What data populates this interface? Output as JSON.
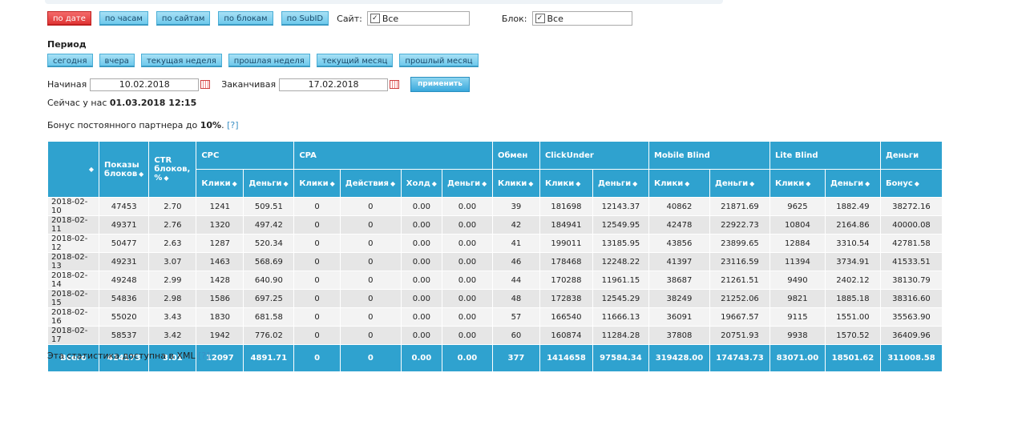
{
  "tabs": [
    "по дате",
    "по часам",
    "по сайтам",
    "по блокам",
    "по SubID"
  ],
  "filters": {
    "site_label": "Сайт:",
    "site_value": "Все",
    "block_label": "Блок:",
    "block_value": "Все"
  },
  "period": {
    "title": "Период",
    "buttons": [
      "сегодня",
      "вчера",
      "текущая неделя",
      "прошлая неделя",
      "текущий месяц",
      "прошлый месяц"
    ]
  },
  "dates": {
    "start_label": "Начиная",
    "start_value": "10.02.2018",
    "end_label": "Заканчивая",
    "end_value": "17.02.2018",
    "apply": "применить"
  },
  "now": {
    "prefix": "Сейчас у нас",
    "value": "01.03.2018 12:15"
  },
  "bonus": {
    "prefix": "Бонус постоянного партнера до",
    "value": "10%",
    "suffix": ".",
    "help": "[?]"
  },
  "table": {
    "groups": [
      "Показы блоков",
      "CTR блоков, %",
      "CPC",
      "CPA",
      "Обмен",
      "ClickUnder",
      "Mobile Blind",
      "Lite Blind",
      "Деньги"
    ],
    "sub": [
      "Клики",
      "Деньги",
      "Клики",
      "Действия",
      "Холд",
      "Деньги",
      "Клики",
      "Клики",
      "Деньги",
      "Клики",
      "Деньги",
      "Клики",
      "Деньги",
      "Бонус"
    ],
    "rows": [
      [
        "2018-02-10",
        "47453",
        "2.70",
        "1241",
        "509.51",
        "0",
        "0",
        "0.00",
        "0.00",
        "39",
        "181698",
        "12143.37",
        "40862",
        "21871.69",
        "9625",
        "1882.49",
        "38272.16"
      ],
      [
        "2018-02-11",
        "49371",
        "2.76",
        "1320",
        "497.42",
        "0",
        "0",
        "0.00",
        "0.00",
        "42",
        "184941",
        "12549.95",
        "42478",
        "22922.73",
        "10804",
        "2164.86",
        "40000.08"
      ],
      [
        "2018-02-12",
        "50477",
        "2.63",
        "1287",
        "520.34",
        "0",
        "0",
        "0.00",
        "0.00",
        "41",
        "199011",
        "13185.95",
        "43856",
        "23899.65",
        "12884",
        "3310.54",
        "42781.58"
      ],
      [
        "2018-02-13",
        "49231",
        "3.07",
        "1463",
        "568.69",
        "0",
        "0",
        "0.00",
        "0.00",
        "46",
        "178468",
        "12248.22",
        "41397",
        "23116.59",
        "11394",
        "3734.91",
        "41533.51"
      ],
      [
        "2018-02-14",
        "49248",
        "2.99",
        "1428",
        "640.90",
        "0",
        "0",
        "0.00",
        "0.00",
        "44",
        "170288",
        "11961.15",
        "38687",
        "21261.51",
        "9490",
        "2402.12",
        "38130.79"
      ],
      [
        "2018-02-15",
        "54836",
        "2.98",
        "1586",
        "697.25",
        "0",
        "0",
        "0.00",
        "0.00",
        "48",
        "172838",
        "12545.29",
        "38249",
        "21252.06",
        "9821",
        "1885.18",
        "38316.60"
      ],
      [
        "2018-02-16",
        "55020",
        "3.43",
        "1830",
        "681.58",
        "0",
        "0",
        "0.00",
        "0.00",
        "57",
        "166540",
        "11666.13",
        "36091",
        "19667.57",
        "9115",
        "1551.00",
        "35563.90"
      ],
      [
        "2018-02-17",
        "58537",
        "3.42",
        "1942",
        "776.02",
        "0",
        "0",
        "0.00",
        "0.00",
        "60",
        "160874",
        "11284.28",
        "37808",
        "20751.93",
        "9938",
        "1570.52",
        "36409.96"
      ]
    ],
    "total": [
      "Всего",
      "414173",
      "3.01",
      "12097",
      "4891.71",
      "0",
      "0",
      "0.00",
      "0.00",
      "377",
      "1414658",
      "97584.34",
      "319428.00",
      "174743.73",
      "83071.00",
      "18501.62",
      "311008.58"
    ]
  },
  "xml": {
    "text": "Эта статистика доступна в XML",
    "help": "[?]"
  }
}
